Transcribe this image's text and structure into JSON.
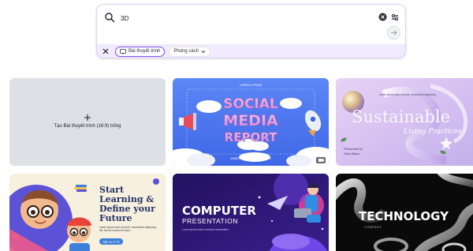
{
  "search": {
    "query": "3D",
    "icons": {
      "search": "search-icon",
      "clear": "clear-icon",
      "filter": "sliders-icon",
      "submit": "arrow-right-icon"
    }
  },
  "chips": {
    "close_icon": "close-icon",
    "selected": {
      "label": "Bài thuyết trình",
      "icon": "presentation-icon"
    },
    "dropdown": {
      "label": "Phong cách",
      "icon": "chevron-down-icon"
    }
  },
  "tiles": {
    "blank": {
      "label": "Tạo Bài thuyết trình (16:9) trống",
      "icon": "plus-icon"
    },
    "social_media": {
      "top_caption": "LOREM & IPSUM",
      "title_lines": [
        "SOCIAL",
        "MEDIA",
        "REPORT"
      ],
      "url": "WWW.REALLYGREATSITE.COM"
    },
    "sustainable": {
      "subtitle_top": "Lorem ipsum dolor sit amet, consectetur adipiscing",
      "title": "Sustainable",
      "script_line": "Living Practices",
      "presenter_label": "Presented by",
      "presenter_name": "Olivia Wilson"
    },
    "learning": {
      "title_lines": [
        "Start",
        "Learning &",
        "Define your",
        "Future"
      ],
      "body": "Lorem ipsum dolor sit amet, consectetur adipiscing elit, sed do eiusmod tempor.",
      "button": "Sign up & Try"
    },
    "computer": {
      "title": "COMPUTER",
      "subtitle": "PRESENTATION",
      "caption": "Lorem ipsum dolor sit amet consectetur"
    },
    "technology": {
      "title": "TECHNOLOGY",
      "subtitle": "COMPANY"
    }
  },
  "colors": {
    "accent": "#7d4ce8",
    "panel": "#f1ebff",
    "blank_tile": "#dde0e5",
    "social_bg": "#4f7bf0",
    "social_title": "#e9a7e0",
    "sustain_bg": "#d9c5f2",
    "learn_bg": "#f7f0de",
    "learn_title": "#243266",
    "computer_bg": "#2c1a72",
    "tech_bg": "#0a0a0a"
  }
}
